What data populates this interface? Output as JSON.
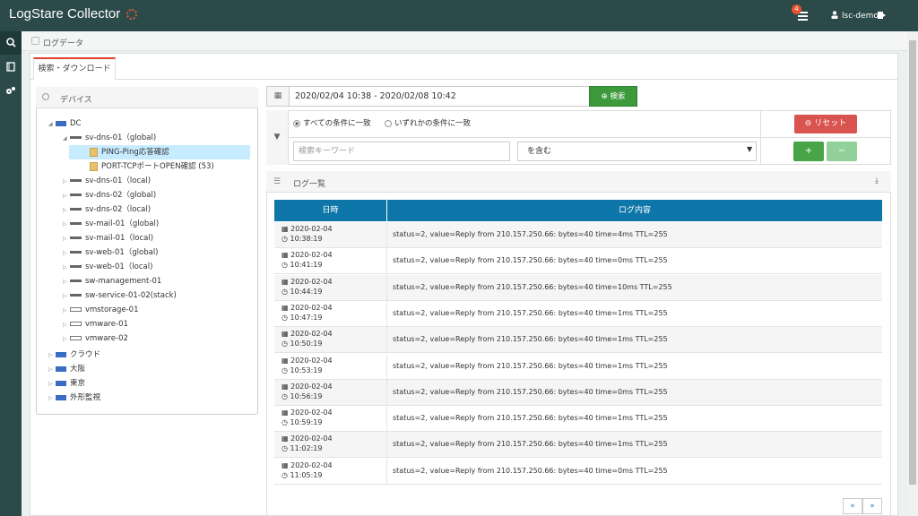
{
  "app": {
    "title": "LogStare Collector",
    "notification_count": "4",
    "user": "lsc-demo"
  },
  "breadcrumb": {
    "label": "ログデータ"
  },
  "tab": {
    "label": "検索・ダウンロード"
  },
  "tree": {
    "header": "デバイス",
    "rows": [
      {
        "label": "DC"
      },
      {
        "label": "sv-dns-01（global)"
      },
      {
        "label": "PING-Ping応答確認"
      },
      {
        "label": "PORT-TCPポートOPEN確認 (53)"
      },
      {
        "label": "sv-dns-01（local)"
      },
      {
        "label": "sv-dns-02（global)"
      },
      {
        "label": "sv-dns-02（local)"
      },
      {
        "label": "sv-mail-01（global)"
      },
      {
        "label": "sv-mail-01（local)"
      },
      {
        "label": "sv-web-01（global)"
      },
      {
        "label": "sv-web-01（local)"
      },
      {
        "label": "sw-management-01"
      },
      {
        "label": "sw-service-01-02(stack)"
      },
      {
        "label": "vmstorage-01"
      },
      {
        "label": "vmware-01"
      },
      {
        "label": "vmware-02"
      },
      {
        "label": "クラウド"
      },
      {
        "label": "大阪"
      },
      {
        "label": "東京"
      },
      {
        "label": "外形監視"
      }
    ]
  },
  "search": {
    "date_range": "2020/02/04 10:38 - 2020/02/08 10:42",
    "button": "検索",
    "match_all": "すべての条件に一致",
    "match_any": "いずれかの条件に一致",
    "reset": "リセット",
    "keyword_placeholder": "検索キーワード",
    "operator": "を含む",
    "add": "+",
    "remove": "−"
  },
  "log": {
    "title": "ログ一覧",
    "col_datetime": "日時",
    "col_content": "ログ内容",
    "rows": [
      {
        "date": "2020-02-04",
        "time": "10:38:19",
        "msg": "status=2, value=Reply from 210.157.250.66: bytes=40 time=4ms TTL=255"
      },
      {
        "date": "2020-02-04",
        "time": "10:41:19",
        "msg": "status=2, value=Reply from 210.157.250.66: bytes=40 time=0ms TTL=255"
      },
      {
        "date": "2020-02-04",
        "time": "10:44:19",
        "msg": "status=2, value=Reply from 210.157.250.66: bytes=40 time=10ms TTL=255"
      },
      {
        "date": "2020-02-04",
        "time": "10:47:19",
        "msg": "status=2, value=Reply from 210.157.250.66: bytes=40 time=1ms TTL=255"
      },
      {
        "date": "2020-02-04",
        "time": "10:50:19",
        "msg": "status=2, value=Reply from 210.157.250.66: bytes=40 time=1ms TTL=255"
      },
      {
        "date": "2020-02-04",
        "time": "10:53:19",
        "msg": "status=2, value=Reply from 210.157.250.66: bytes=40 time=1ms TTL=255"
      },
      {
        "date": "2020-02-04",
        "time": "10:56:19",
        "msg": "status=2, value=Reply from 210.157.250.66: bytes=40 time=0ms TTL=255"
      },
      {
        "date": "2020-02-04",
        "time": "10:59:19",
        "msg": "status=2, value=Reply from 210.157.250.66: bytes=40 time=1ms TTL=255"
      },
      {
        "date": "2020-02-04",
        "time": "11:02:19",
        "msg": "status=2, value=Reply from 210.157.250.66: bytes=40 time=1ms TTL=255"
      },
      {
        "date": "2020-02-04",
        "time": "11:05:19",
        "msg": "status=2, value=Reply from 210.157.250.66: bytes=40 time=0ms TTL=255"
      }
    ]
  },
  "pagination": {
    "prev": "«",
    "next": "»"
  }
}
